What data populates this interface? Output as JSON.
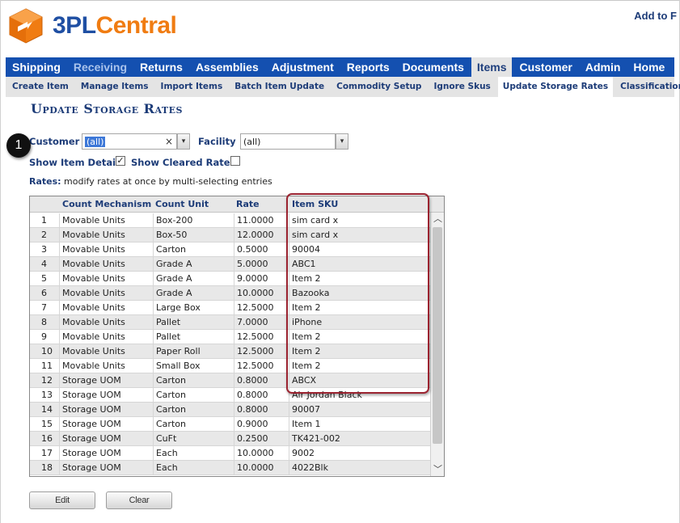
{
  "header": {
    "brand_prefix": "3PL",
    "brand_suffix": "Central",
    "add_to_text": "Add to F"
  },
  "mainnav": {
    "items": [
      {
        "label": "Shipping"
      },
      {
        "label": "Receiving"
      },
      {
        "label": "Returns"
      },
      {
        "label": "Assemblies"
      },
      {
        "label": "Adjustment"
      },
      {
        "label": "Reports"
      },
      {
        "label": "Documents"
      },
      {
        "label": "Items"
      },
      {
        "label": "Customer"
      },
      {
        "label": "Admin"
      },
      {
        "label": "Home"
      }
    ],
    "active": "Items"
  },
  "subnav": {
    "items": [
      {
        "label": "Create Item"
      },
      {
        "label": "Manage Items"
      },
      {
        "label": "Import Items"
      },
      {
        "label": "Batch Item Update"
      },
      {
        "label": "Commodity Setup"
      },
      {
        "label": "Ignore Skus"
      },
      {
        "label": "Update Storage Rates"
      },
      {
        "label": "Classification"
      }
    ],
    "active": "Update Storage Rates"
  },
  "page": {
    "title": "Update Storage Rates"
  },
  "step": {
    "number": "1"
  },
  "filters": {
    "customer_label": "Customer",
    "customer_value": "(all)",
    "clear_glyph": "×",
    "facility_label": "Facility",
    "facility_value": "(all)",
    "dropdown_glyph": "▾",
    "show_item_detail_label": "Show Item Detail",
    "show_item_detail_checked": true,
    "check_glyph": "✓",
    "show_cleared_rates_label": "Show Cleared Rates",
    "show_cleared_rates_checked": false
  },
  "rates_hint": {
    "bold": "Rates:",
    "text": " modify rates at once by multi-selecting entries"
  },
  "table": {
    "columns": [
      "",
      "Count Mechanism",
      "Count Unit",
      "Rate",
      "Item SKU"
    ],
    "rows": [
      [
        "1",
        "Movable Units",
        "Box-200",
        "11.0000",
        "sim card x"
      ],
      [
        "2",
        "Movable Units",
        "Box-50",
        "12.0000",
        "sim card x"
      ],
      [
        "3",
        "Movable Units",
        "Carton",
        "0.5000",
        "90004"
      ],
      [
        "4",
        "Movable Units",
        "Grade A",
        "5.0000",
        "ABC1"
      ],
      [
        "5",
        "Movable Units",
        "Grade A",
        "9.0000",
        "Item 2"
      ],
      [
        "6",
        "Movable Units",
        "Grade A",
        "10.0000",
        "Bazooka"
      ],
      [
        "7",
        "Movable Units",
        "Large Box",
        "12.5000",
        "Item 2"
      ],
      [
        "8",
        "Movable Units",
        "Pallet",
        "7.0000",
        "iPhone"
      ],
      [
        "9",
        "Movable Units",
        "Pallet",
        "12.5000",
        "Item 2"
      ],
      [
        "10",
        "Movable Units",
        "Paper Roll",
        "12.5000",
        "Item 2"
      ],
      [
        "11",
        "Movable Units",
        "Small Box",
        "12.5000",
        "Item 2"
      ],
      [
        "12",
        "Storage UOM",
        "Carton",
        "0.8000",
        "ABCX"
      ],
      [
        "13",
        "Storage UOM",
        "Carton",
        "0.8000",
        "Air Jordan Black"
      ],
      [
        "14",
        "Storage UOM",
        "Carton",
        "0.8000",
        "90007"
      ],
      [
        "15",
        "Storage UOM",
        "Carton",
        "0.9000",
        "Item 1"
      ],
      [
        "16",
        "Storage UOM",
        "CuFt",
        "0.2500",
        "TK421-002"
      ],
      [
        "17",
        "Storage UOM",
        "Each",
        "10.0000",
        "9002"
      ],
      [
        "18",
        "Storage UOM",
        "Each",
        "10.0000",
        "4022Blk"
      ]
    ],
    "scroll_up_glyph": "︿",
    "scroll_down_glyph": "﹀"
  },
  "buttons": {
    "edit": "Edit",
    "clear": "Clear"
  },
  "colors": {
    "nav_blue": "#1450b0",
    "brand_orange": "#f07c12",
    "brand_blue": "#1f4fa3",
    "highlight_red": "#9b2330"
  }
}
